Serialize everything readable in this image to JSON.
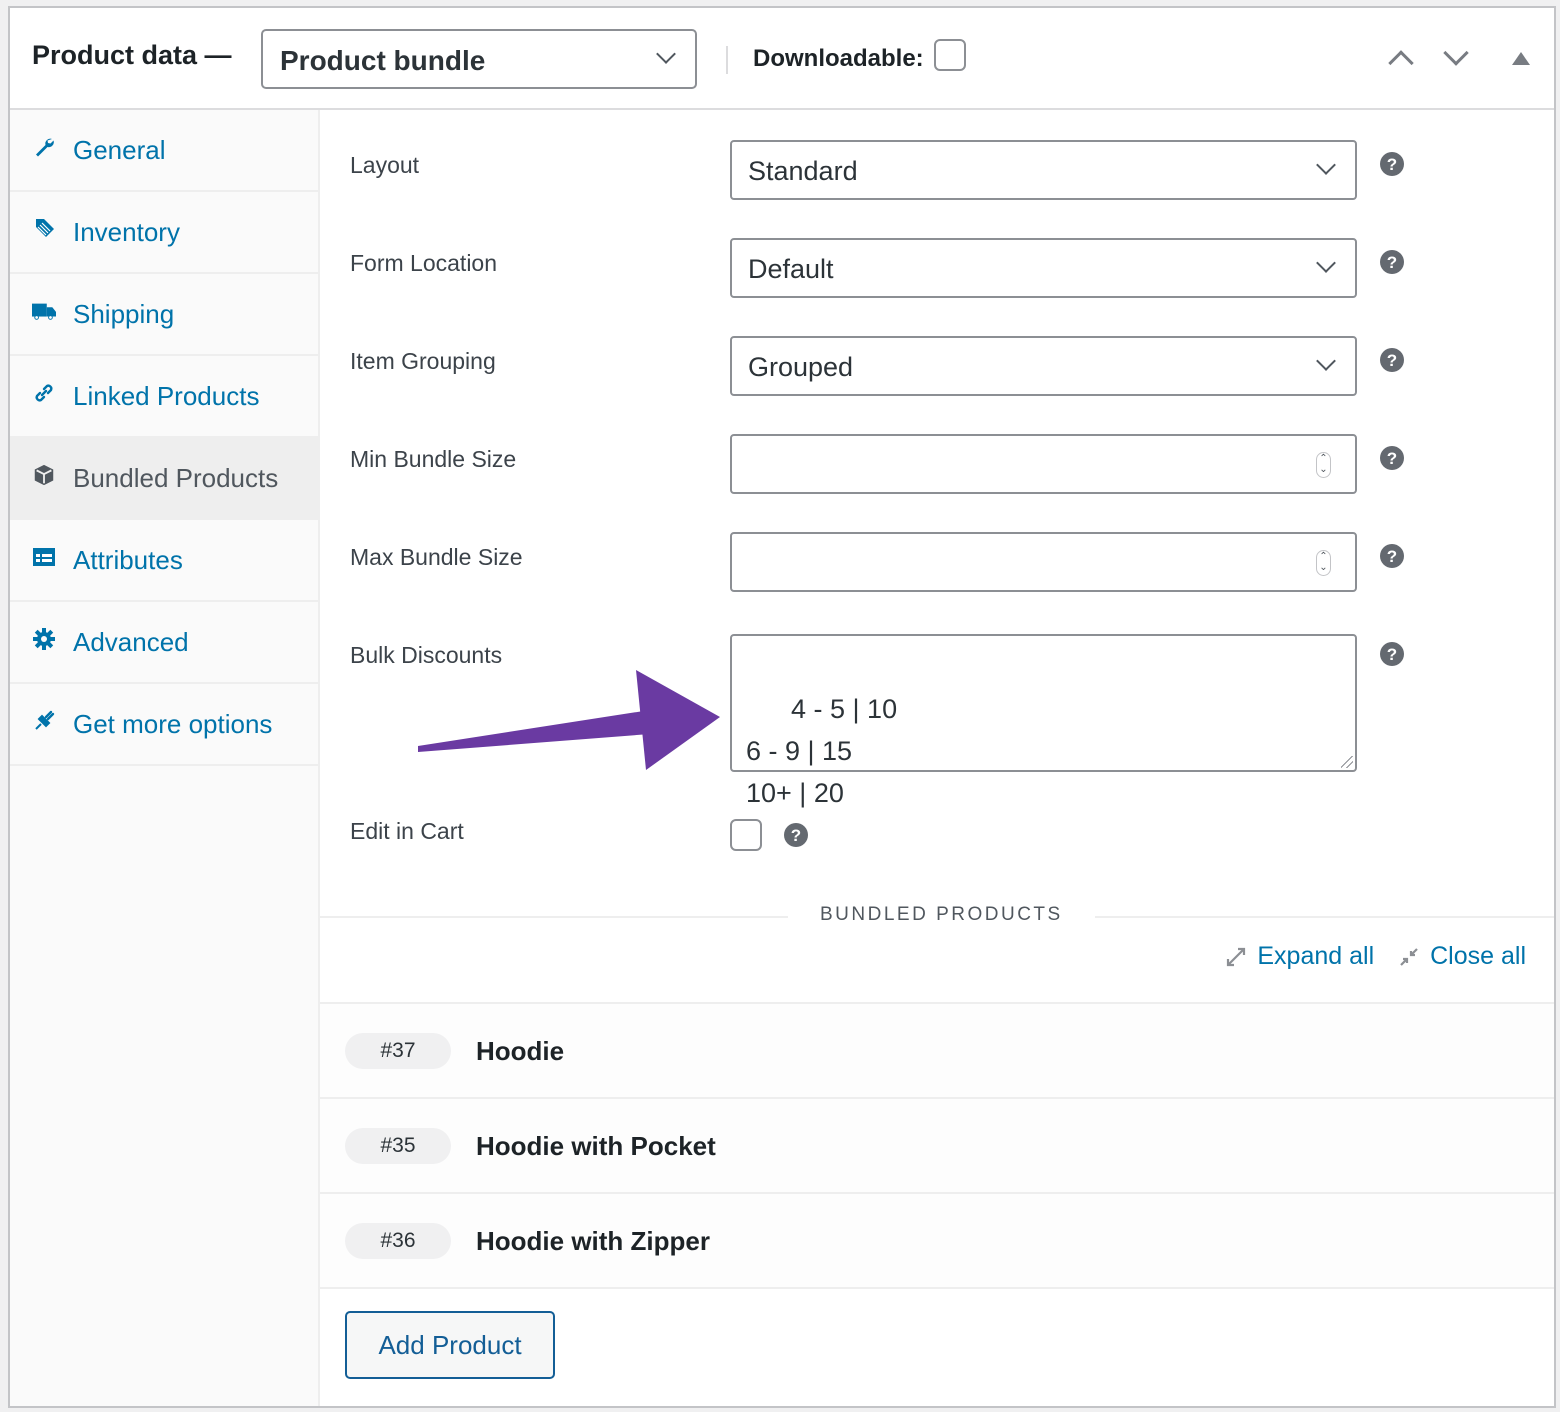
{
  "header": {
    "title": "Product data —",
    "product_type": "Product bundle",
    "downloadable_label": "Downloadable:",
    "downloadable_checked": false,
    "icons": [
      "arrow-up-icon",
      "arrow-down-icon",
      "toggle-panel-icon"
    ]
  },
  "sidebar": {
    "items": [
      {
        "label": "General",
        "icon": "wrench-icon",
        "active": false
      },
      {
        "label": "Inventory",
        "icon": "tag-icon",
        "active": false
      },
      {
        "label": "Shipping",
        "icon": "truck-icon",
        "active": false
      },
      {
        "label": "Linked Products",
        "icon": "link-icon",
        "active": false
      },
      {
        "label": "Bundled Products",
        "icon": "box-icon",
        "active": true
      },
      {
        "label": "Attributes",
        "icon": "list-icon",
        "active": false
      },
      {
        "label": "Advanced",
        "icon": "gear-icon",
        "active": false
      },
      {
        "label": "Get more options",
        "icon": "plug-icon",
        "active": false
      }
    ]
  },
  "form": {
    "layout": {
      "label": "Layout",
      "value": "Standard"
    },
    "form_location": {
      "label": "Form Location",
      "value": "Default"
    },
    "item_grouping": {
      "label": "Item Grouping",
      "value": "Grouped"
    },
    "min_bundle_size": {
      "label": "Min Bundle Size",
      "value": ""
    },
    "max_bundle_size": {
      "label": "Max Bundle Size",
      "value": ""
    },
    "bulk_discounts": {
      "label": "Bulk Discounts",
      "value": "4 - 5 | 10\n6 - 9 | 15\n10+ | 20"
    },
    "edit_in_cart": {
      "label": "Edit in Cart",
      "checked": false
    },
    "help_glyph": "?"
  },
  "bundled": {
    "section_title": "BUNDLED PRODUCTS",
    "expand_all": "Expand all",
    "close_all": "Close all",
    "items": [
      {
        "id": "#37",
        "name": "Hoodie"
      },
      {
        "id": "#35",
        "name": "Hoodie with Pocket"
      },
      {
        "id": "#36",
        "name": "Hoodie with Zipper"
      }
    ],
    "add_button": "Add Product"
  },
  "annotation": {
    "arrow_color": "#6a3aa2"
  },
  "colors": {
    "link": "#0073aa",
    "button": "#135e96"
  }
}
